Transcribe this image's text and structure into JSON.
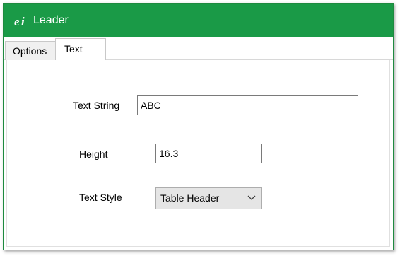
{
  "window": {
    "title": "Leader",
    "accent_color": "#1a9a47",
    "app_icon": "ei-logo-icon"
  },
  "tabs": [
    {
      "label": "Options",
      "active": false
    },
    {
      "label": "Text",
      "active": true
    }
  ],
  "form": {
    "text_string": {
      "label": "Text String",
      "value": "ABC"
    },
    "height": {
      "label": "Height",
      "value": "16.3"
    },
    "text_style": {
      "label": "Text Style",
      "selected": "Table Header",
      "icon": "chevron-down-icon"
    }
  }
}
